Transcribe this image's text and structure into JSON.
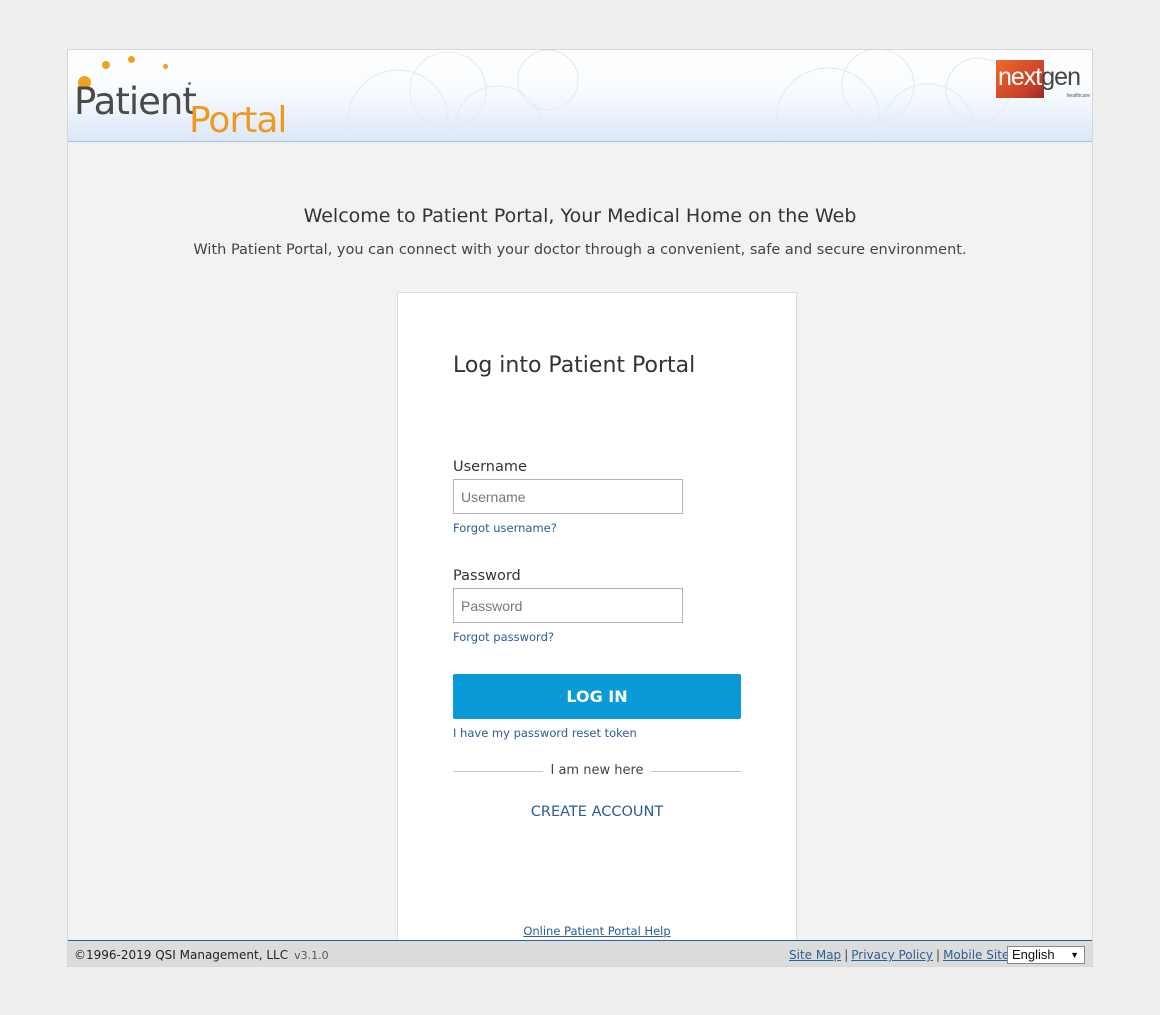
{
  "header": {
    "logo_word1": "Patient",
    "logo_word2": "Portal",
    "brand_part1": "next",
    "brand_part2": "gen",
    "brand_sub": "healthcare"
  },
  "welcome": {
    "title": "Welcome to Patient Portal, Your Medical Home on the Web",
    "subtitle": "With Patient Portal, you can connect with your doctor through a convenient, safe and secure environment."
  },
  "login": {
    "title": "Log into Patient Portal",
    "username_label": "Username",
    "username_placeholder": "Username",
    "username_value": "",
    "forgot_username": "Forgot username?",
    "password_label": "Password",
    "password_placeholder": "Password",
    "password_value": "",
    "forgot_password": "Forgot password?",
    "login_button": "LOG IN",
    "reset_token_link": "I have my password reset token",
    "divider_text": "I am new here",
    "create_account": "CREATE ACCOUNT",
    "help_link": "Online Patient Portal Help"
  },
  "footer": {
    "copyright": "©1996-2019 QSI Management, LLC",
    "version": "v3.1.0",
    "links": [
      "Site Map",
      "Privacy Policy",
      "Mobile Site"
    ],
    "separator": "|",
    "language": "English"
  },
  "colors": {
    "accent_blue": "#0a9ad8",
    "link_blue": "#2b5d96",
    "logo_orange": "#ef9a1f"
  }
}
